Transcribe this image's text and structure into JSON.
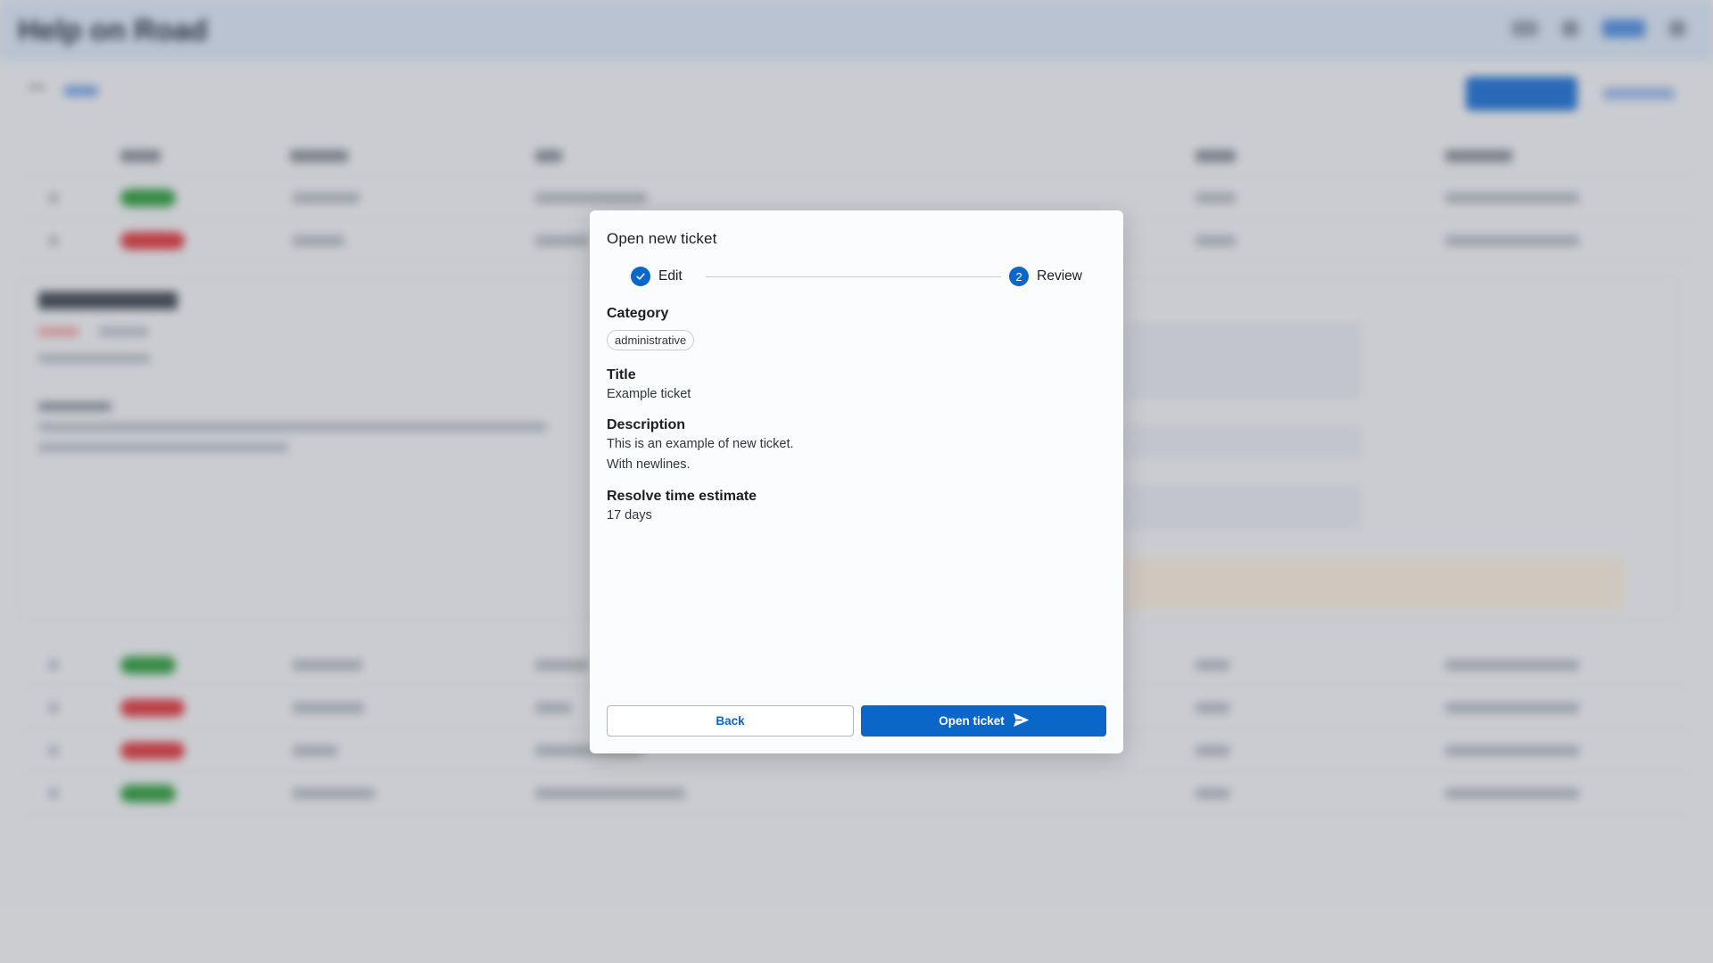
{
  "app": {
    "title": "Help on Road"
  },
  "modal": {
    "title": "Open new ticket",
    "steps": [
      {
        "label": "Edit",
        "state": "completed",
        "icon": "check-icon"
      },
      {
        "label": "Review",
        "state": "active",
        "number": "2"
      }
    ],
    "fields": {
      "category": {
        "label": "Category",
        "value": "administrative"
      },
      "title": {
        "label": "Title",
        "value": "Example ticket"
      },
      "description": {
        "label": "Description",
        "lines": [
          "This is an example of new ticket.",
          "With newlines."
        ]
      },
      "estimate": {
        "label": "Resolve time estimate",
        "value": "17 days"
      }
    },
    "actions": {
      "back_label": "Back",
      "submit_label": "Open ticket",
      "submit_icon": "send-icon"
    }
  },
  "colors": {
    "primary": "#0a66c8",
    "status_ok": "#2e9e3e",
    "status_closed": "#e0393e",
    "header_bg": "#dce8f7"
  }
}
